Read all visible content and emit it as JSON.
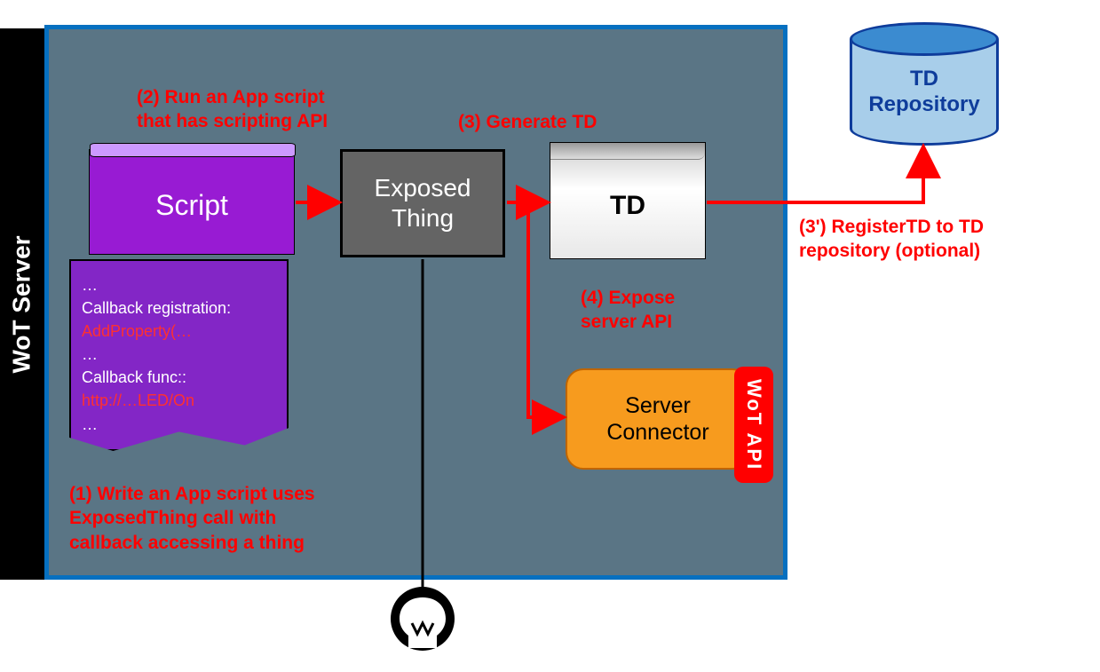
{
  "wot_server_label": "WoT Server",
  "step1": "(1) Write an App script uses ExposedThing call with callback accessing a thing",
  "step2_line1": "(2) Run an App script",
  "step2_line2": "that has scripting API",
  "step3": "(3) Generate TD",
  "step3p_line1": "(3') RegisterTD to TD",
  "step3p_line2": "repository (optional)",
  "step4_line1": "(4) Expose",
  "step4_line2": "server API",
  "script_box_label": "Script",
  "code": {
    "l1": "…",
    "l2": "Callback registration:",
    "l3": "AddProperty(…",
    "l4": "…",
    "l5": "Callback func::",
    "l6": "http://…LED/On",
    "l7": "…"
  },
  "exposed_thing_line1": "Exposed",
  "exposed_thing_line2": "Thing",
  "td_label": "TD",
  "server_connector_line1": "Server",
  "server_connector_line2": "Connector",
  "wot_api_label": "WoT API",
  "td_repo_line1": "TD",
  "td_repo_line2": "Repository"
}
